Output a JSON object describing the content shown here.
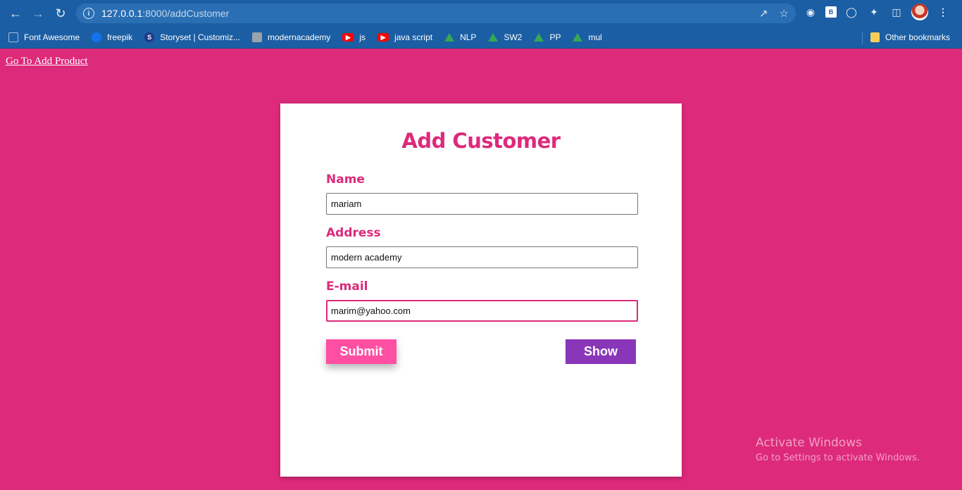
{
  "browser": {
    "url_host": "127.0.0.1",
    "url_path": ":8000/addCustomer",
    "bookmarks": [
      {
        "label": "Font Awesome",
        "icon": "flag-icon"
      },
      {
        "label": "freepik",
        "icon": "freepik-icon"
      },
      {
        "label": "Storyset | Customiz...",
        "icon": "storyset-icon"
      },
      {
        "label": "modernacademy",
        "icon": "modernacademy-icon"
      },
      {
        "label": "js",
        "icon": "youtube-icon"
      },
      {
        "label": "java script",
        "icon": "youtube-icon"
      },
      {
        "label": "NLP",
        "icon": "google-drive-icon"
      },
      {
        "label": "SW2",
        "icon": "google-drive-icon"
      },
      {
        "label": "PP",
        "icon": "google-drive-icon"
      },
      {
        "label": "mul",
        "icon": "google-drive-icon"
      }
    ],
    "other_bookmarks": "Other bookmarks"
  },
  "page": {
    "top_link": "Go To Add Product",
    "form": {
      "title": "Add Customer",
      "name_label": "Name",
      "name_value": "mariam",
      "address_label": "Address",
      "address_value": "modern academy",
      "email_label": "E-mail",
      "email_value": "marim@yahoo.com",
      "submit_label": "Submit",
      "show_label": "Show"
    }
  },
  "watermark": {
    "line1": "Activate Windows",
    "line2": "Go to Settings to activate Windows."
  },
  "colors": {
    "page_bg": "#dd2a7b",
    "browser_bar": "#1b5ea3",
    "submit_bg": "#ff4fa3",
    "show_bg": "#8a36b8"
  }
}
